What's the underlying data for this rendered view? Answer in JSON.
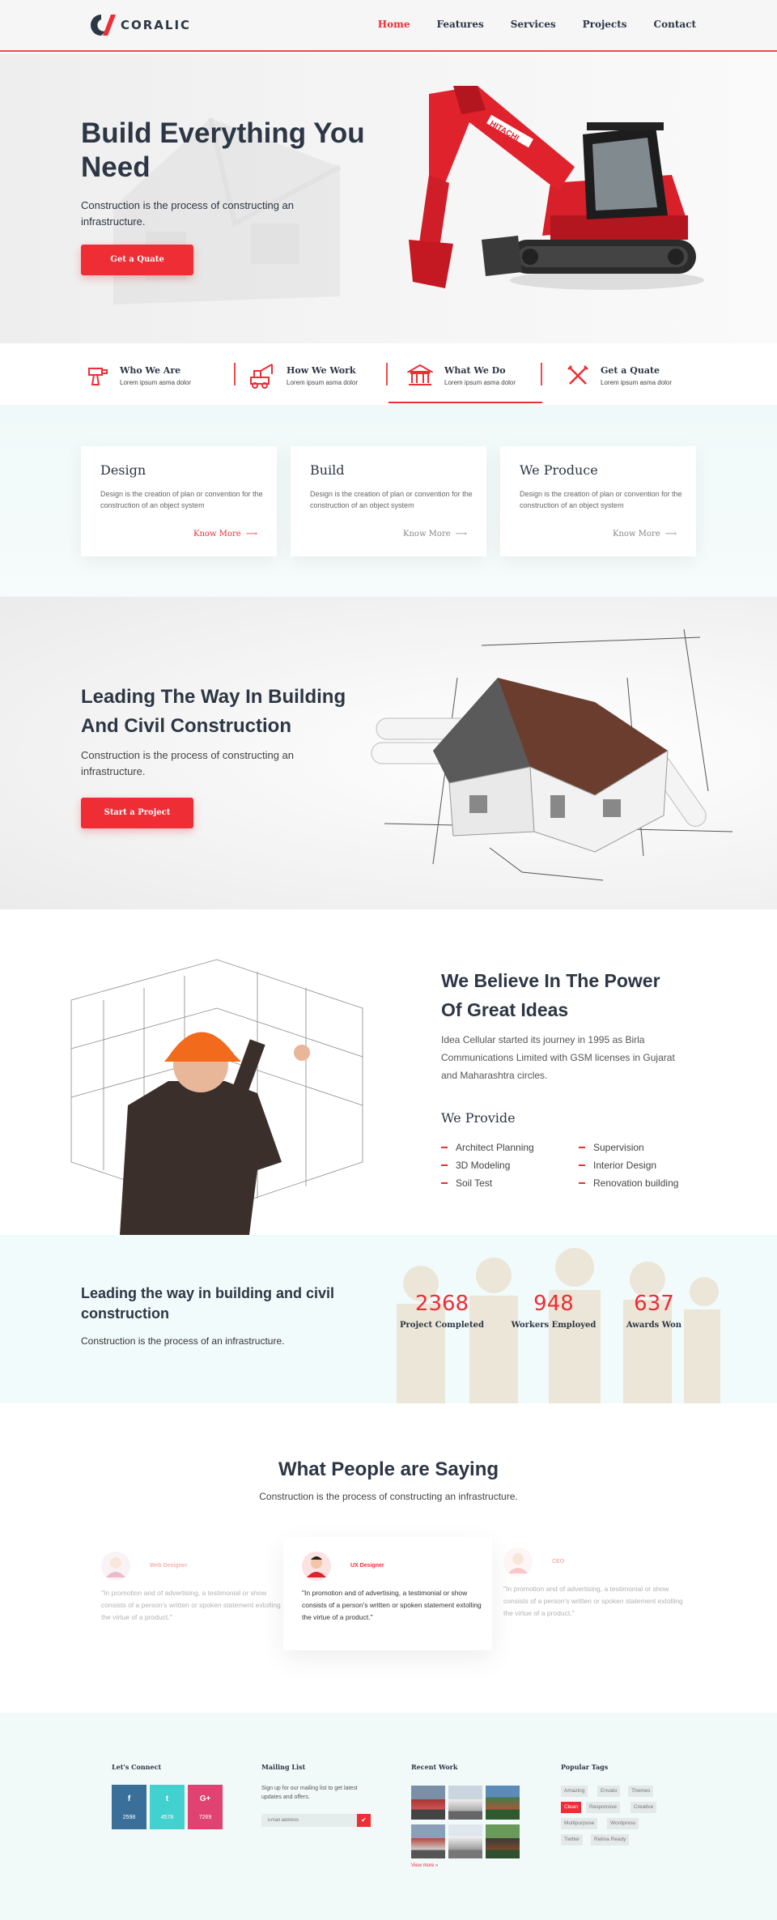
{
  "brand": {
    "logo_text": "CORALIC",
    "accent": "#ee2d35",
    "dark": "#2d3644"
  },
  "nav": {
    "items": [
      "Home",
      "Features",
      "Services",
      "Projects",
      "Contact"
    ],
    "active": "Home"
  },
  "hero": {
    "title": "Build Everything You Need",
    "text": "Construction is the process of constructing an infrastructure.",
    "button": "Get a Quate"
  },
  "strip": {
    "items": [
      {
        "title": "Who We Are",
        "sub": "Lorem ipsum asma dolor",
        "icon": "drill-icon"
      },
      {
        "title": "How We Work",
        "sub": "Lorem ipsum asma dolor",
        "icon": "crane-truck-icon"
      },
      {
        "title": "What We Do",
        "sub": "Lorem ipsum asma dolor",
        "icon": "building-columns-icon"
      },
      {
        "title": "Get a Quate",
        "sub": "Lorem ipsum asma dolor",
        "icon": "tools-icon"
      }
    ],
    "active_index": 2
  },
  "services": {
    "cards": [
      {
        "title": "Design",
        "text": "Design is the creation of plan or convention for the construction of an object system",
        "more": "Know More"
      },
      {
        "title": "Build",
        "text": "Design is the creation of plan or convention for the construction of an object system",
        "more": "Know More"
      },
      {
        "title": "We Produce",
        "text": "Design is the creation of plan or convention for the construction of an object system",
        "more": "Know More"
      }
    ]
  },
  "leading": {
    "title": "Leading The Way In Building And Civil Construction",
    "text": "Construction is the process of constructing an infrastructure.",
    "button": "Start a Project"
  },
  "believe": {
    "title": "We Believe In The Power Of Great Ideas",
    "text": "Idea Cellular started its journey in 1995 as Birla Communications Limited with GSM licenses in Gujarat and Maharashtra circles.",
    "provide_title": "We Provide",
    "provide_items": [
      "Architect Planning",
      "Supervision",
      "3D Modeling",
      "Interior Design",
      "Soil Test",
      "Renovation building"
    ]
  },
  "stats": {
    "title": "Leading the way in building and civil construction",
    "text": "Construction is the process of an infrastructure.",
    "items": [
      {
        "num": "2368",
        "label": "Project Completed"
      },
      {
        "num": "948",
        "label": "Workers Employed"
      },
      {
        "num": "637",
        "label": "Awards Won"
      }
    ]
  },
  "testimonials": {
    "title": "What People are Saying",
    "sub": "Construction is the process of constructing an infrastructure.",
    "items": [
      {
        "role": "Web Designer",
        "quote": "\"In promotion and of advertising, a testimonial or show consists of a person's written or spoken statement extolling the virtue of a product.\""
      },
      {
        "role": "UX Designer",
        "quote": "\"In promotion and of advertising, a testimonial or show consists of a person's written or spoken statement extolling the virtue of a product.\""
      },
      {
        "role": "CEO",
        "quote": "\"In promotion and of advertising, a testimonial or show consists of a person's written or spoken statement extolling the virtue of a product.\""
      }
    ]
  },
  "footer": {
    "connect_title": "Let's Connect",
    "social": [
      {
        "icon": "f",
        "name": "facebook-icon",
        "count": "2598",
        "color": "#3a6f9a"
      },
      {
        "icon": "t",
        "name": "twitter-icon",
        "count": "4578",
        "color": "#43d1cf"
      },
      {
        "icon": "G+",
        "name": "google-plus-icon",
        "count": "7269",
        "color": "#e04272"
      }
    ],
    "mailing_title": "Mailing List",
    "mailing_text": "Sign up for our mailing list to get latest updates and offers.",
    "mailing_placeholder": "Email address",
    "recent_title": "Recent Work",
    "view_more": "View more »",
    "tags_title": "Popular Tags",
    "tags": [
      "Amazing",
      "Envato",
      "Themes",
      "Clean",
      "Responsive",
      "Creative",
      "Multipurpose",
      "Wordpress",
      "Twitter",
      "Retina Ready"
    ],
    "active_tag": "Clean"
  }
}
